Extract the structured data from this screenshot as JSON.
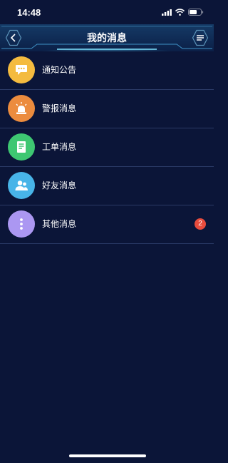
{
  "status_bar": {
    "time": "14:48"
  },
  "header": {
    "title": "我的消息"
  },
  "messages": [
    {
      "label": "通知公告",
      "icon": "chat-bubble-icon",
      "color": "#f4bb3f"
    },
    {
      "label": "警报消息",
      "icon": "alarm-light-icon",
      "color": "#ec8c3e"
    },
    {
      "label": "工单消息",
      "icon": "document-icon",
      "color": "#3ec772"
    },
    {
      "label": "好友消息",
      "icon": "friends-icon",
      "color": "#48b4e8"
    },
    {
      "label": "其他消息",
      "icon": "more-dots-icon",
      "color": "#ab97f2",
      "badge": "2"
    }
  ]
}
